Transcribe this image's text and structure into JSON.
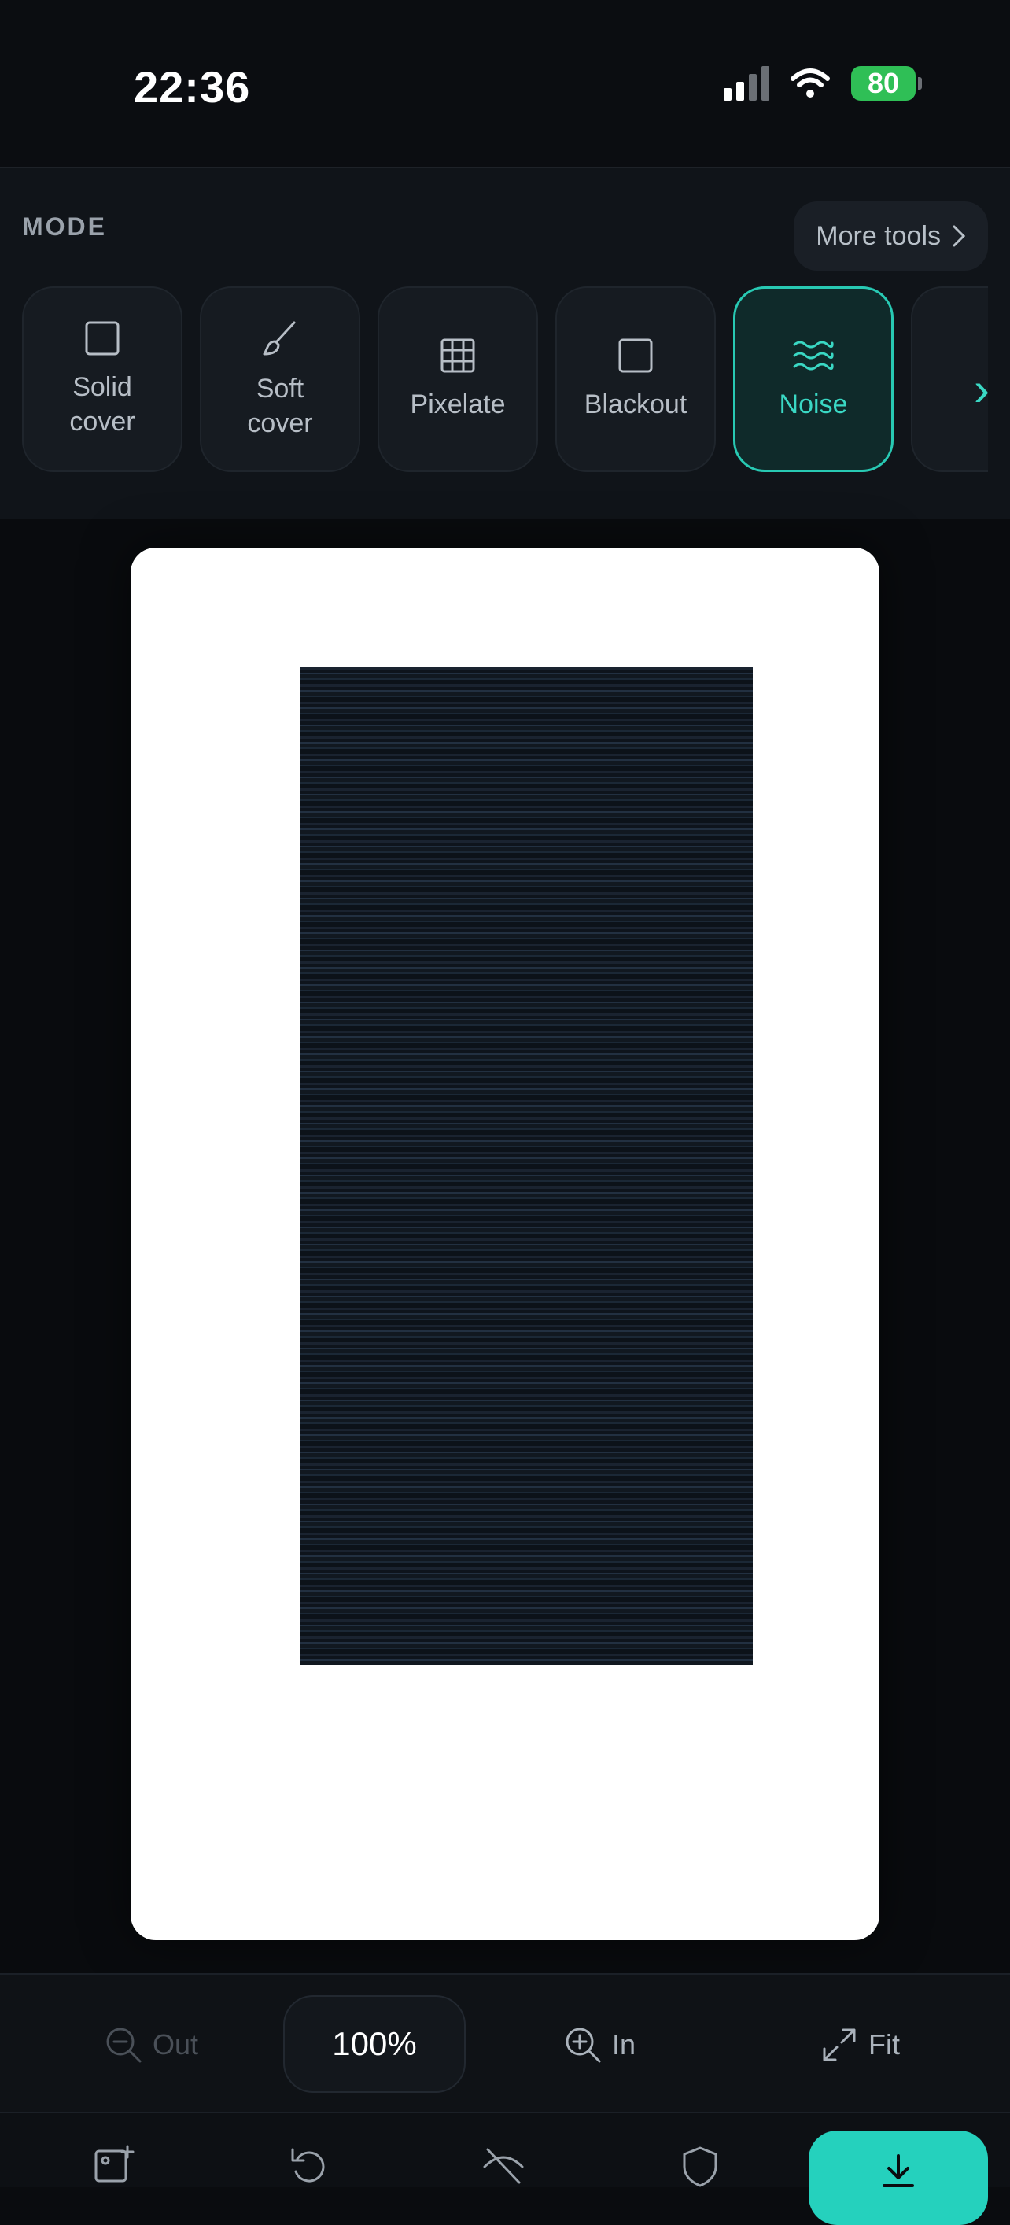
{
  "status": {
    "time": "22:36",
    "battery": "80"
  },
  "mode": {
    "label": "MODE",
    "more_tools": "More tools",
    "tools": [
      {
        "label": "Solid\ncover",
        "icon": "square-icon"
      },
      {
        "label": "Soft\ncover",
        "icon": "brush-icon"
      },
      {
        "label": "Pixelate",
        "icon": "grid-icon"
      },
      {
        "label": "Blackout",
        "icon": "square-icon"
      },
      {
        "label": "Noise",
        "icon": "waves-icon",
        "active": true
      }
    ]
  },
  "zoom": {
    "out": "Out",
    "value": "100%",
    "in": "In",
    "fit": "Fit"
  },
  "colors": {
    "accent": "#25d1bd",
    "background": "#0a0c0f"
  }
}
